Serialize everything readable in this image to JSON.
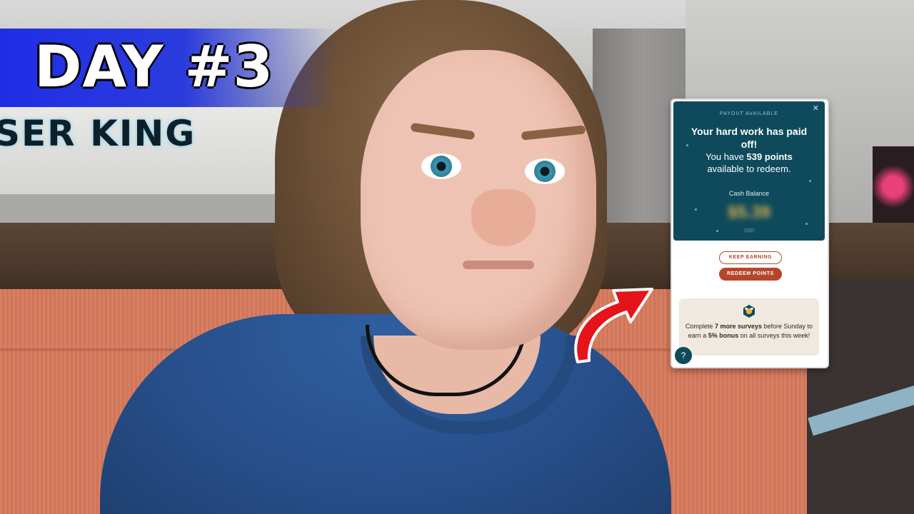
{
  "banner": {
    "text": "DAY #3",
    "color": "#1f2ee6"
  },
  "sign": {
    "text": "SER KING"
  },
  "popup": {
    "payout_label": "PAYOUT AVAILABLE",
    "headline_line1": "Your hard work has paid",
    "headline_line2": "off!",
    "subline_prefix": "You have ",
    "points": "539 points",
    "subline_suffix": "available to redeem.",
    "cash_label": "Cash Balance",
    "cash_amount": "$5.39",
    "cash_currency": "USD",
    "keep_button": "KEEP EARNING",
    "redeem_button": "REDEEM POINTS",
    "bonus_prefix": "Complete ",
    "bonus_surveys": "7 more surveys",
    "bonus_mid": " before Sunday to earn a ",
    "bonus_pct": "5% bonus",
    "bonus_suffix": " on all surveys this week!",
    "accent_color": "#0e4a5c",
    "button_color": "#b5462a"
  },
  "icons": [
    "close-icon",
    "bonus-badge-icon",
    "help-icon",
    "red-arrow-icon"
  ]
}
